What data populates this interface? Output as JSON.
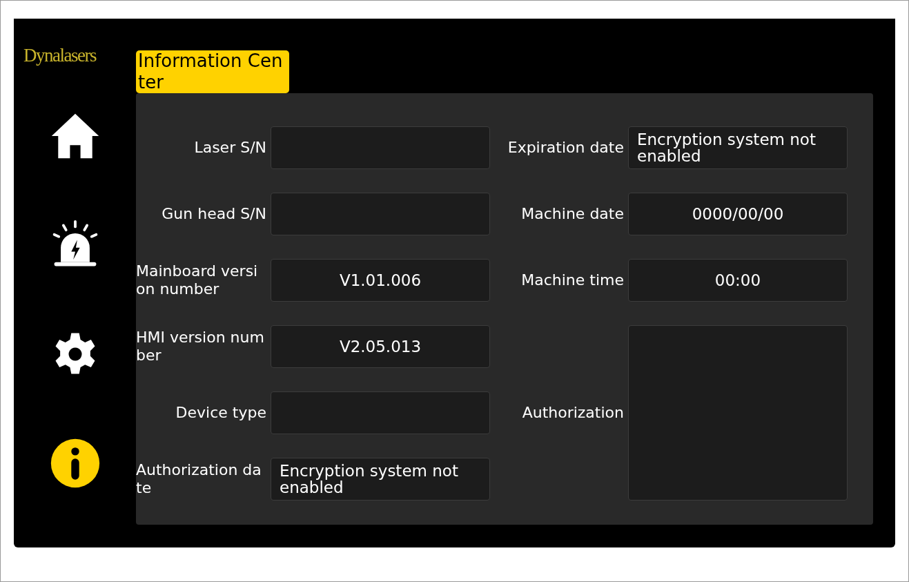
{
  "brand": "Dynalasers",
  "title": "Information Center",
  "nav": [
    {
      "kind": "home",
      "selected": false
    },
    {
      "kind": "alarm",
      "selected": false
    },
    {
      "kind": "settings",
      "selected": false
    },
    {
      "kind": "info",
      "selected": true
    }
  ],
  "left_fields": [
    {
      "label": "Laser S/N"
    },
    {
      "label": "Gun head S/N"
    },
    {
      "label": "Mainboard version number",
      "value": "V1.01.006"
    },
    {
      "label": "HMI version number",
      "value": "V2.05.013"
    },
    {
      "label": "Device type"
    },
    {
      "label": "Authorization date",
      "value": "Encryption system not enabled"
    }
  ],
  "right_fields": [
    {
      "label": "Expiration date",
      "value": "Encryption system not enabled",
      "kind": "normal"
    },
    {
      "label": "Machine date",
      "value": "0000/00/00",
      "kind": "normal"
    },
    {
      "label": "Machine time",
      "value": "00:00",
      "kind": "normal"
    },
    {
      "label": "Authorization",
      "kind": "tall"
    }
  ]
}
